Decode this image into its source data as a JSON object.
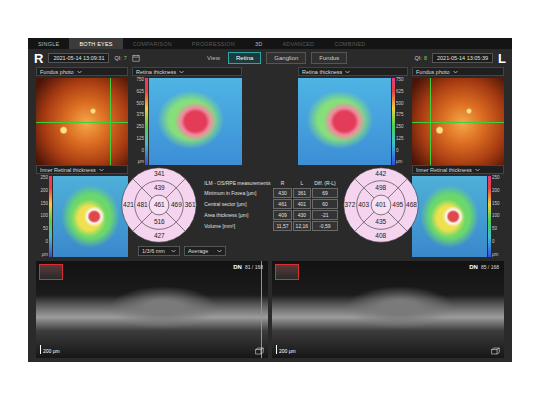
{
  "tabs": [
    {
      "label": "SINGLE",
      "selected": false,
      "disabled": false
    },
    {
      "label": "BOTH EYES",
      "selected": true,
      "disabled": false
    },
    {
      "label": "COMPARISON",
      "selected": false,
      "disabled": true
    },
    {
      "label": "PROGRESSION",
      "selected": false,
      "disabled": true
    },
    {
      "label": "3D",
      "selected": false,
      "disabled": false
    },
    {
      "label": "ADVANCED",
      "selected": false,
      "disabled": true
    },
    {
      "label": "COMBINED",
      "selected": false,
      "disabled": true
    }
  ],
  "view": {
    "label": "View",
    "buttons": [
      {
        "label": "Retina",
        "selected": true
      },
      {
        "label": "Ganglion",
        "selected": false
      },
      {
        "label": "Fundus",
        "selected": false
      }
    ]
  },
  "eyes": [
    {
      "side": "R",
      "timestamp": "2021-05-14 13:09:31",
      "qi_label": "QI:",
      "qi": "7",
      "fundus_title": "Fundus photo",
      "retina_title": "Retina thickness",
      "retina_scale": {
        "ticks": [
          "750",
          "625",
          "500",
          "375",
          "250",
          "125",
          "0"
        ],
        "unit": "μm"
      },
      "inner_title": "Inner Retinal thickness",
      "inner_scale": {
        "ticks": [
          "250",
          "200",
          "150",
          "100",
          "50",
          "0"
        ],
        "unit": "μm"
      },
      "grid": {
        "outer_top": "341",
        "inner_top": "439",
        "outer_left": "421",
        "inner_left": "481",
        "center": "461",
        "inner_right": "469",
        "outer_right": "361",
        "inner_bottom": "516",
        "outer_bottom": "427"
      },
      "scan": {
        "label": "DN",
        "position": "81 / 168",
        "scale": "200 μm"
      }
    },
    {
      "side": "L",
      "timestamp": "2021-05-14 13:05:39",
      "qi_label": "QI:",
      "qi": "8",
      "fundus_title": "Fundus photo",
      "retina_title": "Retina thickness",
      "retina_scale": {
        "ticks": [
          "750",
          "625",
          "500",
          "375",
          "250",
          "125",
          "0"
        ],
        "unit": "μm"
      },
      "inner_title": "Inner Retinal thickness",
      "inner_scale": {
        "ticks": [
          "250",
          "200",
          "150",
          "100",
          "50",
          "0"
        ],
        "unit": "μm"
      },
      "grid": {
        "outer_top": "442",
        "inner_top": "498",
        "outer_left": "372",
        "inner_left": "403",
        "center": "401",
        "inner_right": "495",
        "outer_right": "468",
        "inner_bottom": "435",
        "outer_bottom": "408"
      },
      "scan": {
        "label": "DN",
        "position": "85 / 168",
        "scale": "200 μm"
      }
    }
  ],
  "table": {
    "title": "ILM - OS/RPE measurements",
    "columns": [
      "R",
      "L",
      "Diff. (R-L)"
    ],
    "rows": [
      [
        "Minimum in Fovea [μm]",
        "430",
        "361",
        "69"
      ],
      [
        "Central sector [μm]",
        "461",
        "401",
        "60"
      ],
      [
        "Area thickness [μm]",
        "409",
        "430",
        "-21"
      ],
      [
        "Volume [mm³]",
        "11,57",
        "12,16",
        "-0,59"
      ]
    ]
  },
  "dropdowns": [
    "1/3/6 mm",
    "Average"
  ]
}
